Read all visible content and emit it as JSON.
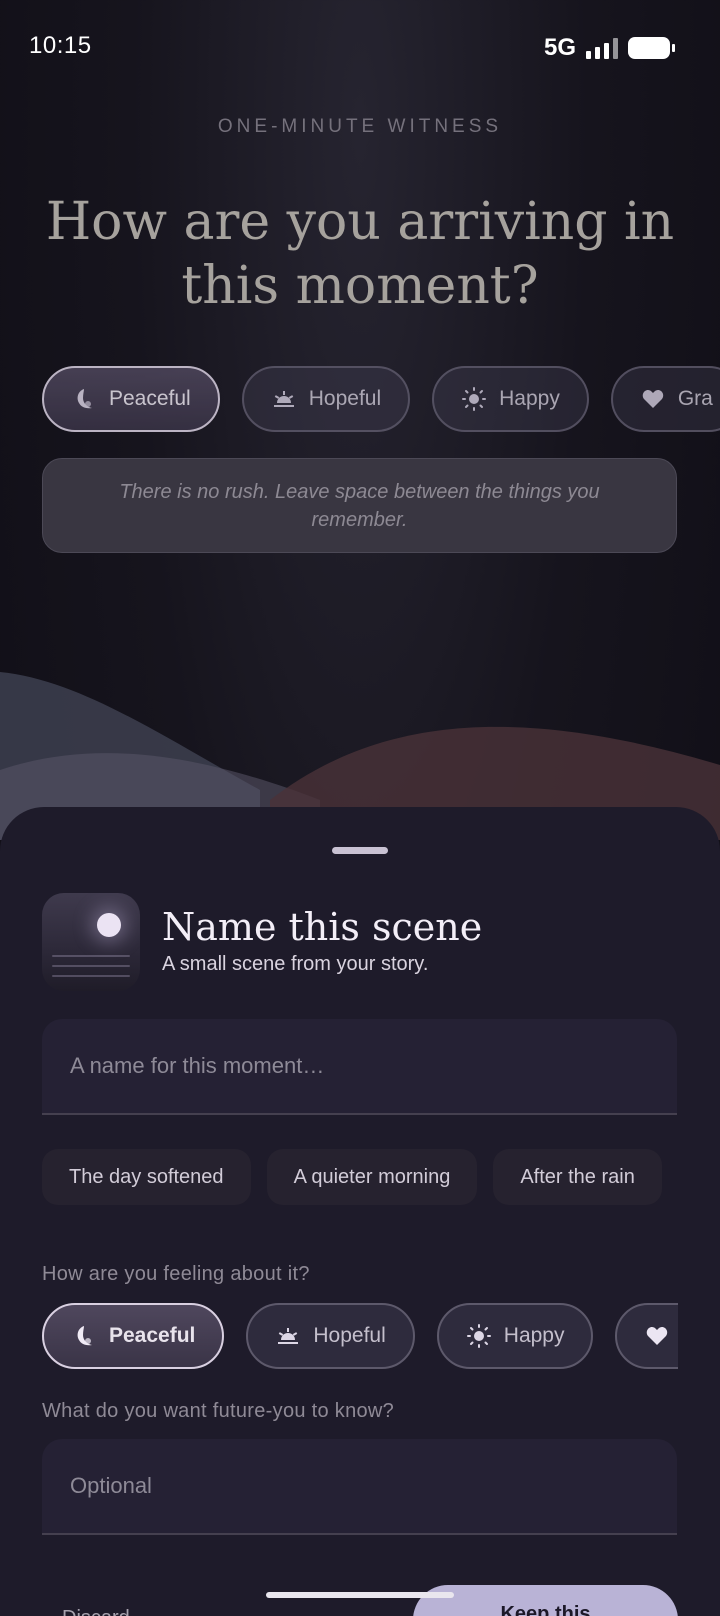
{
  "status": {
    "time": "10:15",
    "network": "5G"
  },
  "header": {
    "eyebrow": "ONE-MINUTE WITNESS",
    "headline": "How are you arriving in this moment?"
  },
  "top_moods": [
    {
      "label": "Peaceful",
      "icon": "moon-icon",
      "selected": true
    },
    {
      "label": "Hopeful",
      "icon": "sunrise-icon",
      "selected": false
    },
    {
      "label": "Happy",
      "icon": "sun-icon",
      "selected": false
    },
    {
      "label": "Gra",
      "icon": "heart-icon",
      "selected": false
    }
  ],
  "quote": "There is no rush. Leave space between the things you remember.",
  "sheet": {
    "title": "Name this scene",
    "subtitle": "A small scene from your story.",
    "name_placeholder": "A name for this moment…",
    "suggestions": [
      "The day softened",
      "A quieter morning",
      "After the rain"
    ],
    "feeling_label": "How are you feeling about it?",
    "moods": [
      {
        "label": "Peaceful",
        "icon": "moon-icon",
        "selected": true
      },
      {
        "label": "Hopeful",
        "icon": "sunrise-icon",
        "selected": false
      },
      {
        "label": "Happy",
        "icon": "sun-icon",
        "selected": false
      },
      {
        "label": "",
        "icon": "heart-icon",
        "selected": false
      }
    ],
    "future_label": "What do you want future-you to know?",
    "note_placeholder": "Optional",
    "discard_label": "Discard",
    "keep_label": "Keep this"
  },
  "colors": {
    "accent": "#b9b3d6",
    "sheet": "#1e1b2a",
    "background": "#16141d"
  }
}
